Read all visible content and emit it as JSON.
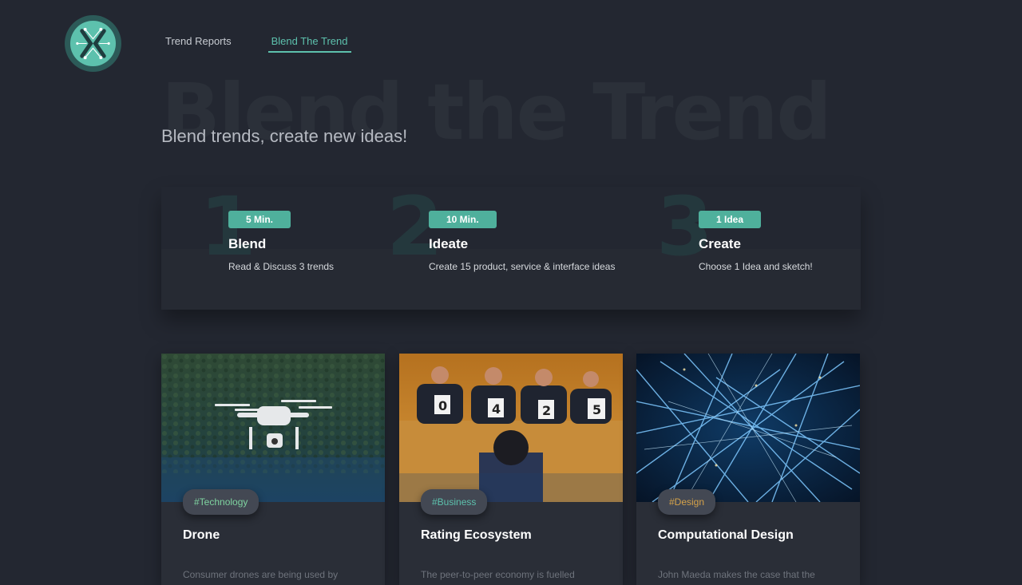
{
  "colors": {
    "background": "#232731",
    "accent": "#5dc1ad",
    "badge": "#4fb09c",
    "tag_technology": "#7fd3a0",
    "tag_business": "#5dc1ad",
    "tag_design": "#d4a24a"
  },
  "logo": {
    "icon": "x-circuit-logo-icon"
  },
  "nav": {
    "items": [
      {
        "label": "Trend Reports",
        "active": false
      },
      {
        "label": "Blend The Trend",
        "active": true
      }
    ]
  },
  "hero": {
    "background_title": "Blend the Trend",
    "subtitle": "Blend trends, create new ideas!"
  },
  "steps": [
    {
      "number": "1",
      "badge": "5 Min.",
      "title": "Blend",
      "description": "Read & Discuss 3 trends"
    },
    {
      "number": "2",
      "badge": "10 Min.",
      "title": "Ideate",
      "description": "Create 15 product, service & interface ideas"
    },
    {
      "number": "3",
      "badge": "1 Idea",
      "title": "Create",
      "description": "Choose 1 Idea and sketch!"
    }
  ],
  "cards": [
    {
      "tag": "#Technology",
      "title": "Drone",
      "text": "Consumer drones are being used by",
      "image": "drone-photo"
    },
    {
      "tag": "#Business",
      "title": "Rating Ecosystem",
      "text": "The peer-to-peer economy is fuelled",
      "image": "judges-photo"
    },
    {
      "tag": "#Design",
      "title": "Computational Design",
      "text": "John Maeda makes the case that the",
      "image": "network-lines-photo"
    }
  ]
}
